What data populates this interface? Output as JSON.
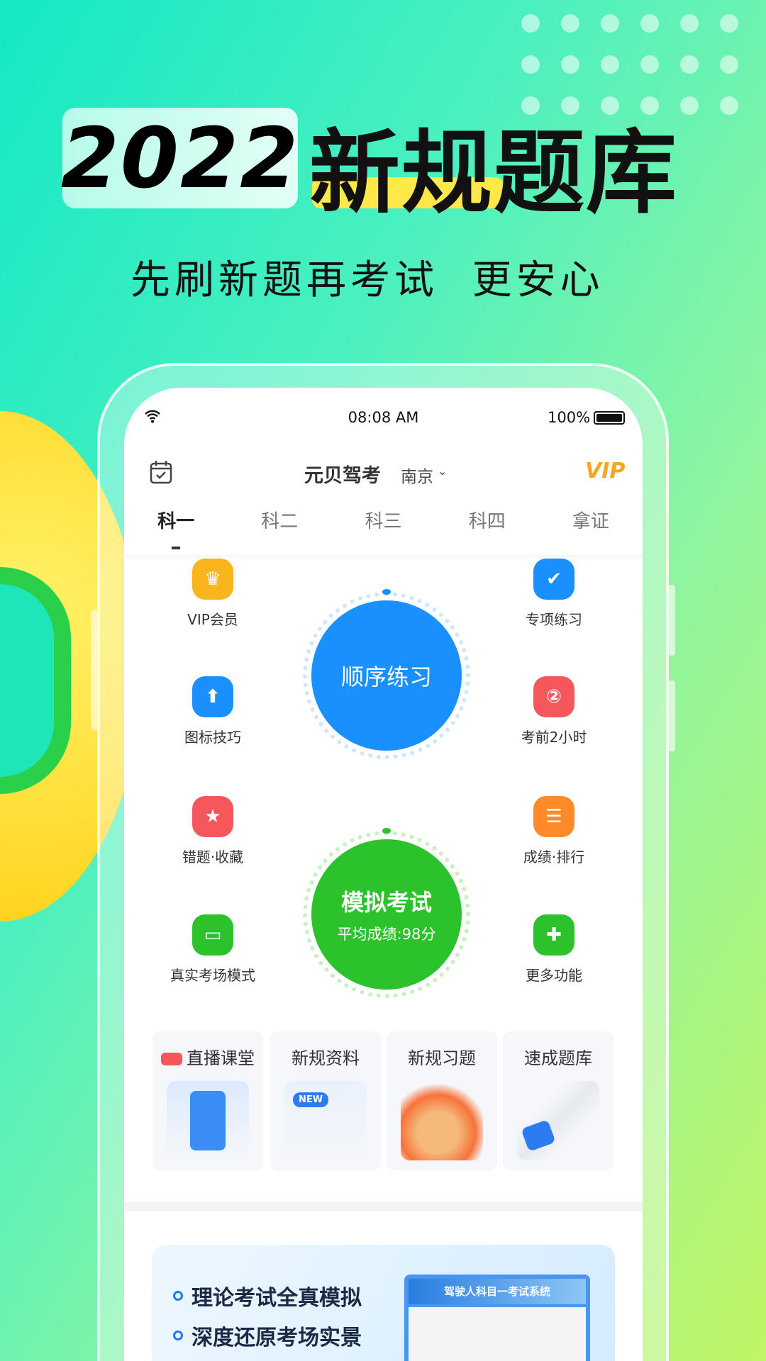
{
  "promo": {
    "year": "2022",
    "title": "新规题库",
    "subtitle": "先刷新题再考试  更安心"
  },
  "status_bar": {
    "time": "08:08 AM",
    "battery": "100%"
  },
  "header": {
    "app_name": "元贝驾考",
    "city": "南京",
    "vip_badge": "VIP"
  },
  "tabs": [
    {
      "label": "科一",
      "active": true
    },
    {
      "label": "科二"
    },
    {
      "label": "科三"
    },
    {
      "label": "科四"
    },
    {
      "label": "拿证"
    }
  ],
  "features_left": [
    {
      "label": "VIP会员",
      "icon": "crown-icon",
      "color": "#f8b51c"
    },
    {
      "label": "图标技巧",
      "icon": "arrow-up-icon",
      "color": "#1a90ff"
    },
    {
      "label": "错题·收藏",
      "icon": "star-icon",
      "color": "#f5575c"
    },
    {
      "label": "真实考场模式",
      "icon": "monitor-icon",
      "color": "#2cc22c"
    }
  ],
  "features_right": [
    {
      "label": "专项练习",
      "icon": "clipboard-icon",
      "color": "#1a90ff"
    },
    {
      "label": "考前2小时",
      "icon": "timer-icon",
      "color": "#f5575c"
    },
    {
      "label": "成绩·排行",
      "icon": "list-icon",
      "color": "#ff8a2a"
    },
    {
      "label": "更多功能",
      "icon": "grid-icon",
      "color": "#2cc22c"
    }
  ],
  "practice": {
    "sequential": "顺序练习",
    "mock_exam": "模拟考试",
    "avg_score": "平均成绩:98分"
  },
  "cards": [
    {
      "label": "直播课堂",
      "badge": "live"
    },
    {
      "label": "新规资料",
      "tag": "NEW"
    },
    {
      "label": "新规习题"
    },
    {
      "label": "速成题库"
    }
  ],
  "banner": {
    "lines": [
      "理论考试全真模拟",
      "深度还原考场实景"
    ],
    "screen_title": "驾驶人科目一考试系统"
  },
  "colors": {
    "blue": "#1a90ff",
    "green": "#2cc22c",
    "vip": "#f5a623"
  }
}
